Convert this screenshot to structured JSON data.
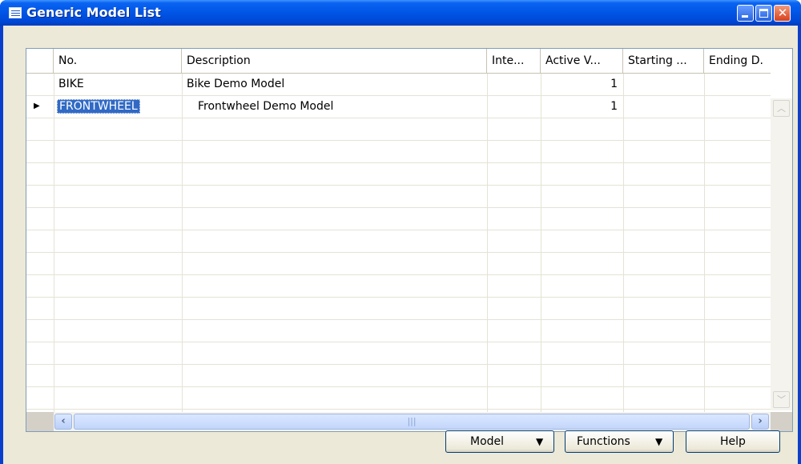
{
  "window": {
    "title": "Generic Model List"
  },
  "columns": [
    {
      "label": "No."
    },
    {
      "label": "Description"
    },
    {
      "label": "Inte..."
    },
    {
      "label": "Active V..."
    },
    {
      "label": "Starting ..."
    },
    {
      "label": "Ending D."
    }
  ],
  "rows": [
    {
      "no": "BIKE",
      "description": "Bike Demo Model",
      "active_version": "1",
      "selected": false
    },
    {
      "no": "FRONTWHEEL",
      "description": "Frontwheel Demo Model",
      "active_version": "1",
      "selected": true
    }
  ],
  "buttons": {
    "model_label": "Model",
    "functions_label": "Functions",
    "help_label": "Help"
  },
  "icons": {
    "window": "table-icon",
    "row_pointer": "triangle-right-icon",
    "dropdown": "triangle-down-icon"
  },
  "colors": {
    "titlebar": "#0055e5",
    "selection": "#316ac5",
    "dialog_bg": "#ece9d8"
  }
}
